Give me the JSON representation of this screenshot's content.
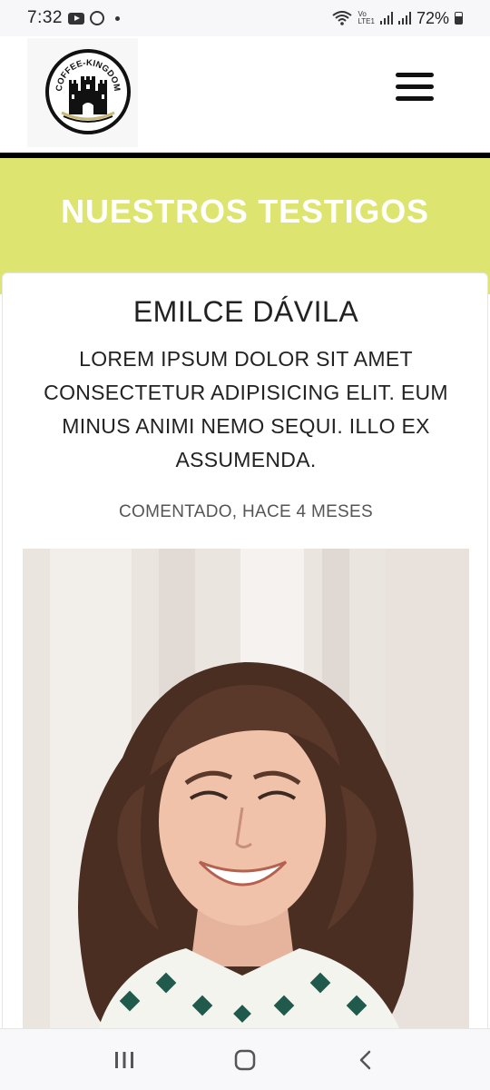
{
  "status_bar": {
    "time": "7:32",
    "notification_icons": [
      "gallery-icon",
      "youtube-icon",
      "whatsapp-icon",
      "dot-icon"
    ],
    "system_icons": [
      "wifi-icon",
      "volte-icon",
      "signal-icon",
      "signal-icon"
    ],
    "volte_label": "Vo\nLTE1",
    "battery_percent": "72%"
  },
  "header": {
    "logo_text": "COFFEE-KINGDOM",
    "menu_icon": "hamburger-icon"
  },
  "banner": {
    "title": "NUESTROS TESTIGOS"
  },
  "testimonial": {
    "name": "EMILCE DÁVILA",
    "quote": "LOREM IPSUM DOLOR SIT AMET CONSECTETUR ADIPISICING ELIT. EUM MINUS ANIMI NEMO SEQUI. ILLO EX ASSUMENDA.",
    "meta": "COMENTADO, HACE 4 MESES"
  },
  "colors": {
    "banner_bg": "#dde46f",
    "banner_text": "#ffffff",
    "text": "#222222"
  },
  "nav_bar": {
    "icons": [
      "recent-apps-icon",
      "home-icon",
      "back-icon"
    ]
  }
}
